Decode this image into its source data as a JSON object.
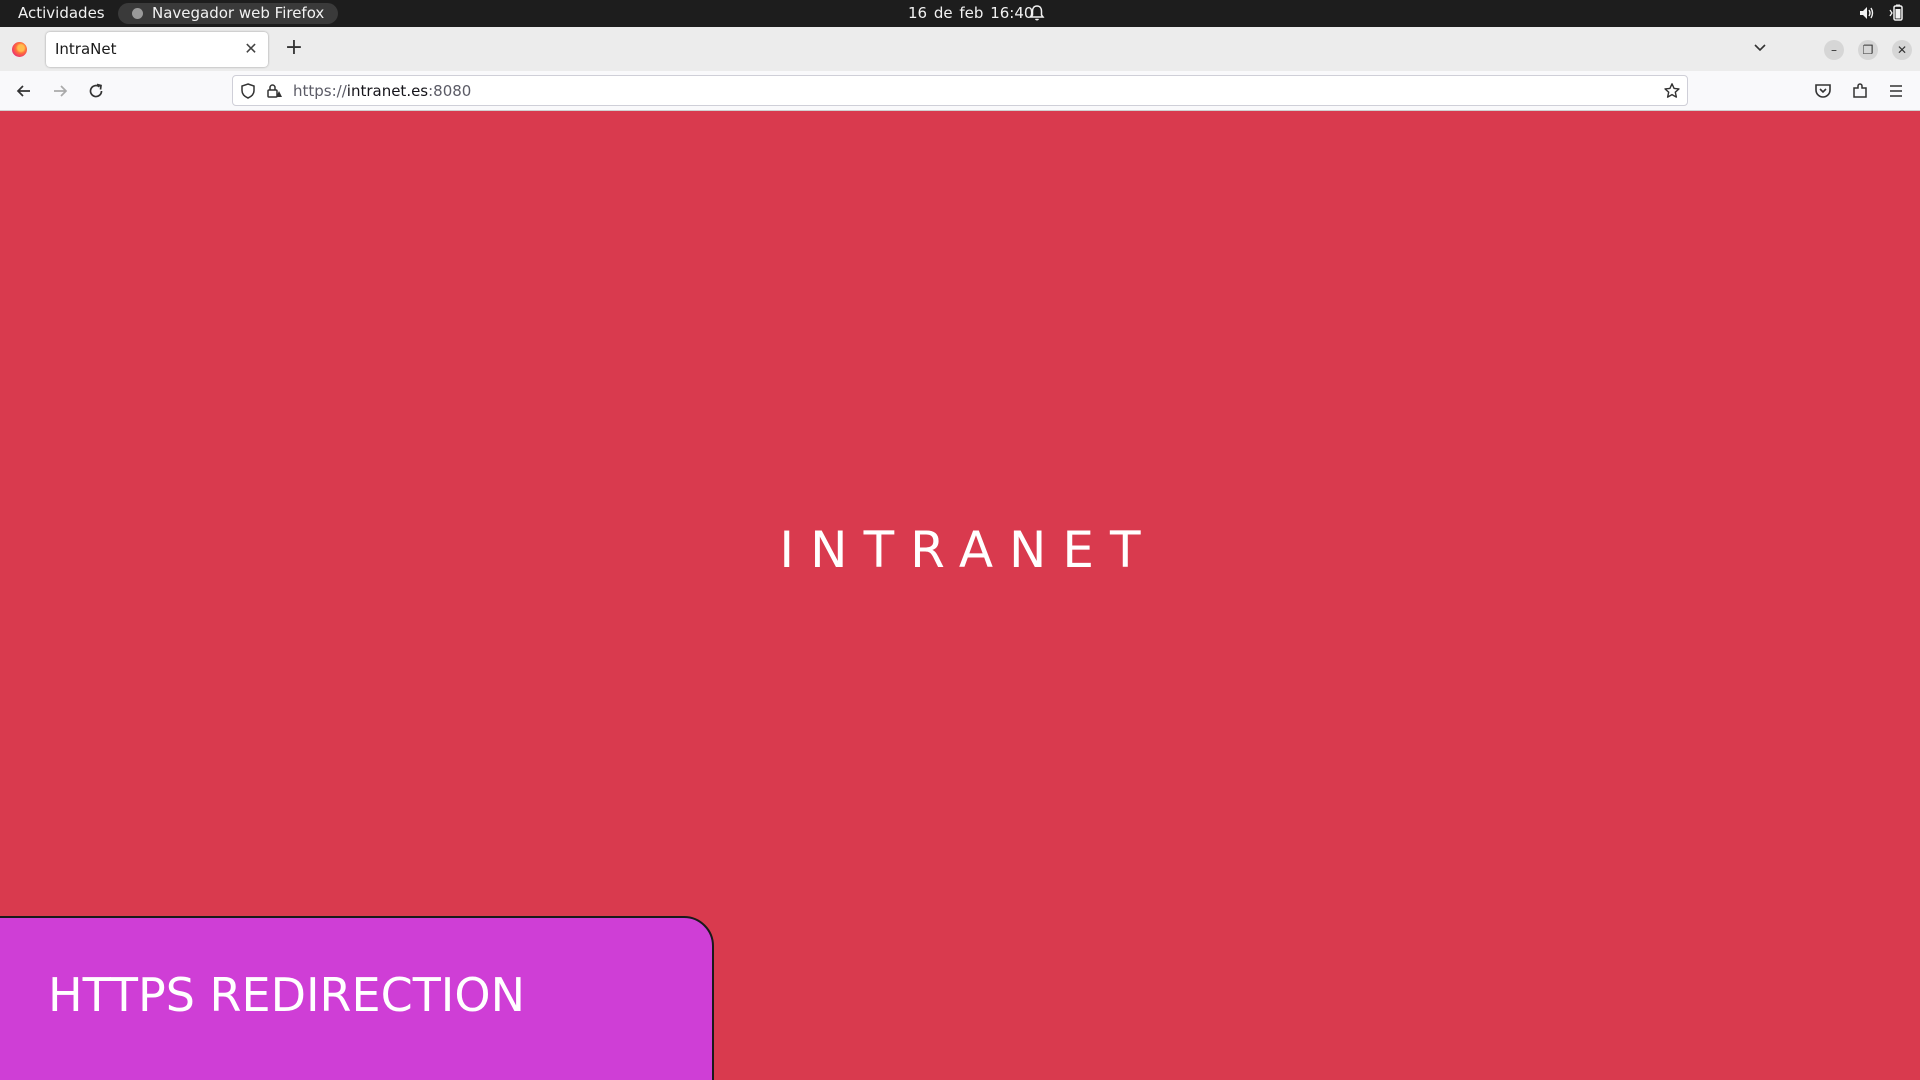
{
  "system_bar": {
    "activities": "Actividades",
    "app_name": "Navegador web Firefox",
    "date": "16 de feb",
    "time": "16:40"
  },
  "browser": {
    "tab_title": "IntraNet",
    "url_scheme": "https://",
    "url_host": "intranet.es",
    "url_port": ":8080"
  },
  "page": {
    "hero_title": "INTRANET",
    "card_title": "HTTPS REDIRECTION"
  },
  "colors": {
    "page_background": "#d93a4e",
    "card_background": "#cf3ed6"
  }
}
